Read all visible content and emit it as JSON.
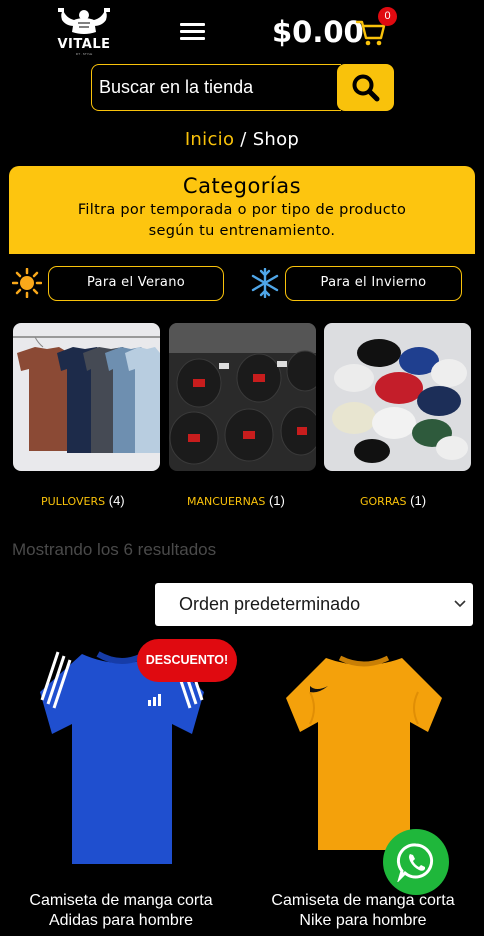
{
  "brand": {
    "name": "VITALE",
    "tagline": "FIT · STYLE"
  },
  "cart": {
    "total": "$0.00",
    "count": "0"
  },
  "search": {
    "placeholder": "Buscar en la tienda"
  },
  "breadcrumb": {
    "home": "Inicio",
    "separator": " / ",
    "current": "Shop"
  },
  "categories": {
    "title": "Categorías",
    "subtitle_line1": "Filtra por temporada o por tipo de producto",
    "subtitle_line2": "según tu entrenamiento."
  },
  "season": {
    "summer": "Para el Verano",
    "winter": "Para el Invierno"
  },
  "category_cards": [
    {
      "name": "PULLOVERS",
      "count": "(4)"
    },
    {
      "name": "MANCUERNAS",
      "count": "(1)"
    },
    {
      "name": "GORRAS",
      "count": "(1)"
    }
  ],
  "results_text": "Mostrando los 6 resultados",
  "sort": {
    "selected": "Orden predeterminado"
  },
  "products": [
    {
      "name_line1": "Camiseta de manga corta",
      "name_line2": "Adidas para hombre",
      "badge": "DESCUENTO!",
      "color": "#1f4fcf"
    },
    {
      "name_line1": "Camiseta de manga corta",
      "name_line2": "Nike para hombre",
      "color": "#f4a10b"
    }
  ],
  "colors": {
    "accent": "#f9c20b",
    "badge": "#e00a10",
    "whatsapp": "#1fb73b"
  }
}
